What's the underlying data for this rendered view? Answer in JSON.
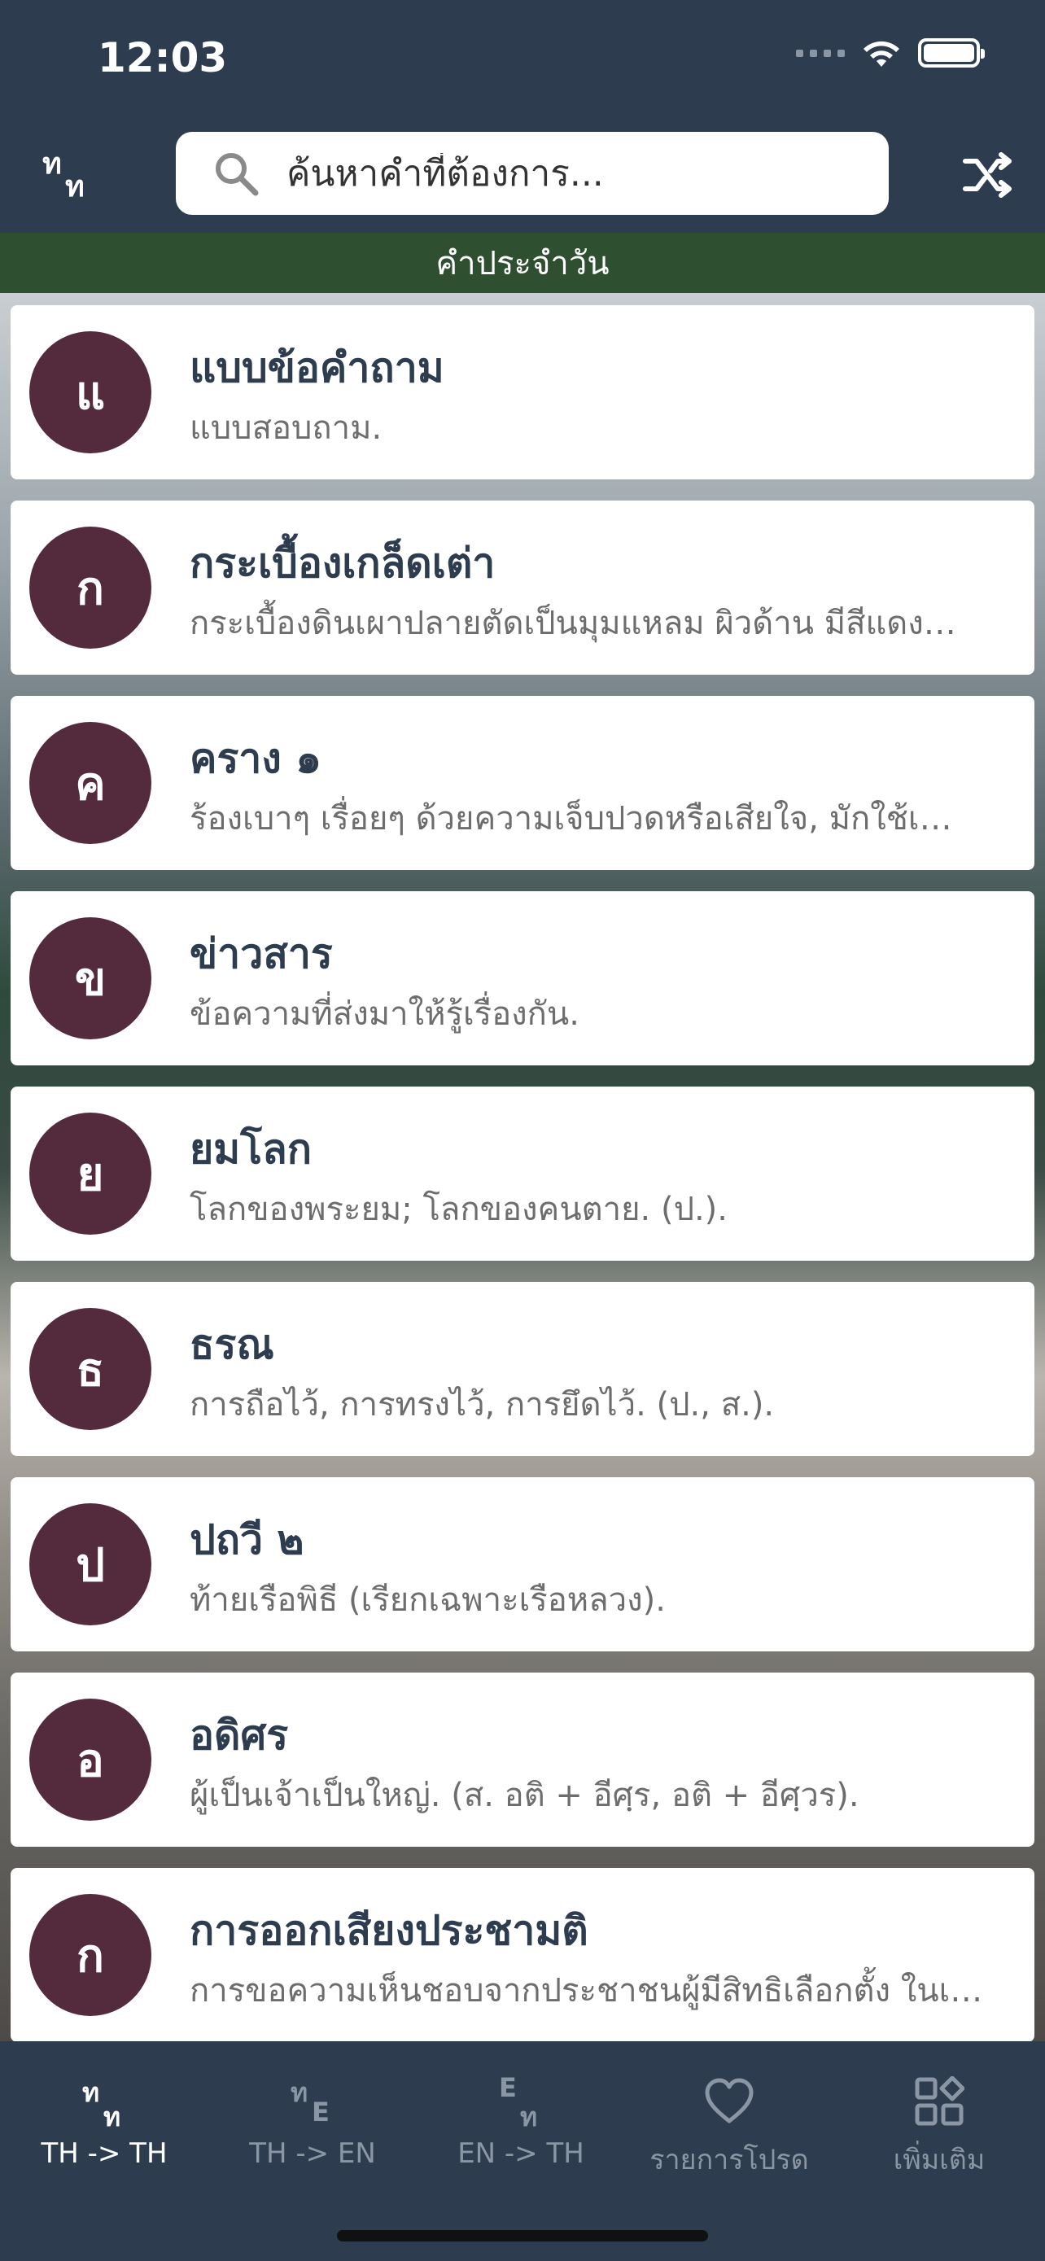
{
  "status": {
    "time": "12:03"
  },
  "header": {
    "logo": {
      "glyph1": "ท",
      "glyph2": "ท"
    },
    "search_placeholder": "ค้นหาคำที่ต้องการ...",
    "shuffle_icon": "shuffle-icon"
  },
  "daily": {
    "label": "คำประจำวัน"
  },
  "words": [
    {
      "initial": "แ",
      "word": "แบบข้อคำถาม",
      "definition": "แบบสอบถาม."
    },
    {
      "initial": "ก",
      "word": "กระเบื้องเกล็ดเต่า",
      "definition": "กระเบื้องดินเผาปลายตัดเป็นมุมแหลม ผิวด้าน มีสีแดง…"
    },
    {
      "initial": "ค",
      "word": "คราง ๑",
      "definition": "ร้องเบาๆ เรื่อยๆ ด้วยความเจ็บปวดหรือเสียใจ, มักใช้เ…"
    },
    {
      "initial": "ข",
      "word": "ข่าวสาร",
      "definition": "ข้อความที่ส่งมาให้รู้เรื่องกัน."
    },
    {
      "initial": "ย",
      "word": "ยมโลก",
      "definition": "โลกของพระยม; โลกของคนตาย.  (ป.)."
    },
    {
      "initial": "ธ",
      "word": "ธรณ",
      "definition": "การถือไว้, การทรงไว้, การยึดไว้.  (ป., ส.)."
    },
    {
      "initial": "ป",
      "word": "ปถวี ๒",
      "definition": "ท้ายเรือพิธี (เรียกเฉพาะเรือหลวง)."
    },
    {
      "initial": "อ",
      "word": "อดิศร",
      "definition": "ผู้เป็นเจ้าเป็นใหญ่.  (ส. อติ + อีศฺร, อติ + อีศฺวร)."
    },
    {
      "initial": "ก",
      "word": "การออกเสียงประชามติ",
      "definition": "การขอความเห็นชอบจากประชาชนผู้มีสิทธิเลือกตั้ง ในเ…"
    }
  ],
  "tabs": [
    {
      "label": "TH -> TH",
      "glyph_top": "ท",
      "glyph_bottom": "ท",
      "active": true
    },
    {
      "label": "TH -> EN",
      "glyph_top": "ท",
      "glyph_bottom": "E",
      "active": false
    },
    {
      "label": "EN -> TH",
      "glyph_top": "E",
      "glyph_bottom": "ท",
      "active": false
    },
    {
      "label": "รายการโปรด",
      "icon": "heart-icon",
      "active": false
    },
    {
      "label": "เพิ่มเติม",
      "icon": "grid-icon",
      "active": false
    }
  ],
  "colors": {
    "header_bg": "#2d3c4f",
    "daily_bar_bg": "#2f5030",
    "avatar_bg": "#532b3c",
    "inactive_tab": "#8a96a4"
  }
}
